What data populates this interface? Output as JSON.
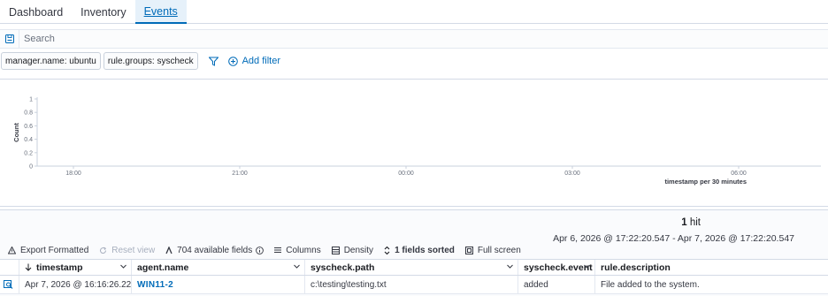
{
  "tabs": [
    {
      "label": "Dashboard",
      "active": false
    },
    {
      "label": "Inventory",
      "active": false
    },
    {
      "label": "Events",
      "active": true
    }
  ],
  "search": {
    "placeholder": "Search",
    "value": ""
  },
  "filters": [
    "manager.name: ubuntu",
    "rule.groups: syscheck"
  ],
  "add_filter_label": "Add filter",
  "chart_data": {
    "type": "bar",
    "ylabel": "Count",
    "xlabel": "timestamp per 30 minutes",
    "yticks": [
      "1",
      "0.8",
      "0.6",
      "0.4",
      "0.2",
      "0"
    ],
    "ylim": [
      0,
      1
    ],
    "xticks": [
      "18:00",
      "21:00",
      "00:00",
      "03:00",
      "06:00"
    ],
    "categories": [],
    "values": []
  },
  "results": {
    "hits_count": "1",
    "hits_label": "hit",
    "range": "Apr 6, 2026 @ 17:22:20.547 - Apr 7, 2026 @ 17:22:20.547"
  },
  "toolbar": {
    "export": "Export Formatted",
    "reset": "Reset view",
    "fields": "704 available fields",
    "columns": "Columns",
    "density": "Density",
    "sorted": "1 fields sorted",
    "fullscreen": "Full screen"
  },
  "columns": [
    "timestamp",
    "agent.name",
    "syscheck.path",
    "syscheck.event",
    "rule.description"
  ],
  "rows": [
    {
      "timestamp": "Apr 7, 2026 @ 16:16:26.220",
      "agent": "WIN11-2",
      "path": "c:\\testing\\testing.txt",
      "event": "added",
      "description": "File added to the system."
    }
  ],
  "colors": {
    "accent": "#006bb8",
    "text": "#343741",
    "border": "#d3dae6"
  }
}
